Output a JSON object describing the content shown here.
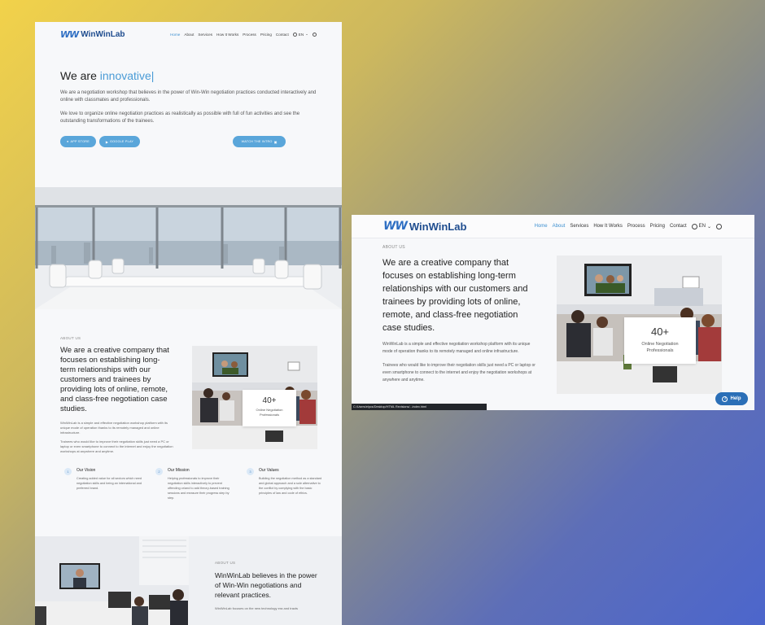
{
  "brand": {
    "logo_mark": "WW",
    "logo_text": "WinWinLab"
  },
  "nav": {
    "items": [
      "Home",
      "About",
      "Services",
      "How It Works",
      "Process",
      "Pricing",
      "Contact"
    ],
    "language": "EN"
  },
  "hero": {
    "title_prefix": "We are",
    "title_accent": "innovative|",
    "para1": "We are a negotiation workshop that believes in the power of Win-Win negotiation practices conducted interactively and online with classmates and professionals.",
    "para2": "We love to organize online negotiation practices as realistically as possible with full of fun activities and see the outstanding transformations of the trainees.",
    "btn_app_store": "APP STORE",
    "btn_google_play": "GOOGLE PLAY",
    "btn_watch_intro": "WATCH THE INTRO"
  },
  "about": {
    "eyebrow": "ABOUT US",
    "heading": "We are a creative company that focuses on establishing long-term relationships with our customers and trainees by providing lots of online, remote, and class-free negotiation case studies.",
    "para1": "WinWinLab is a simple and effective negotiation workshop platform with its unique mode of operation thanks to its remotely managed and online infrastructure.",
    "para2": "Trainees who would like to improve their negotiation skills just need a PC or laptop or even smartphone to connect to the internet and enjoy the negotiation workshops at anywhere and anytime.",
    "stat_number": "40+",
    "stat_label": "Online Negotiation Professionals"
  },
  "values": [
    {
      "num": "1",
      "title": "Our Vision",
      "text": "Creating added value for all sectors which need negotiation skills and being an international and preferred brand."
    },
    {
      "num": "2",
      "title": "Our Mission",
      "text": "Helping professionals to improve their negotiation skills interactively to prevent offending or/and to add theory-based training sessions and measure their progress step by step."
    },
    {
      "num": "3",
      "title": "Our Values",
      "text": "Building the negotiation method as a standard and global approach and a sole alternative to the conflict by complying with the basic principles of law and code of ethics."
    }
  ],
  "belief": {
    "eyebrow": "ABOUT US",
    "heading": "WinWinLab believes in the power of Win-Win negotiations and relevant practices.",
    "text": "WinWinLab focuses on the new technology era and tracts"
  },
  "help_label": "Help",
  "status_url": "C:/Users/elpcs/Desktop/HTML Revisions/...index.html",
  "colors": {
    "accent": "#4a9bd6",
    "brand": "#2f6fc3",
    "help": "#2b6fb7"
  }
}
